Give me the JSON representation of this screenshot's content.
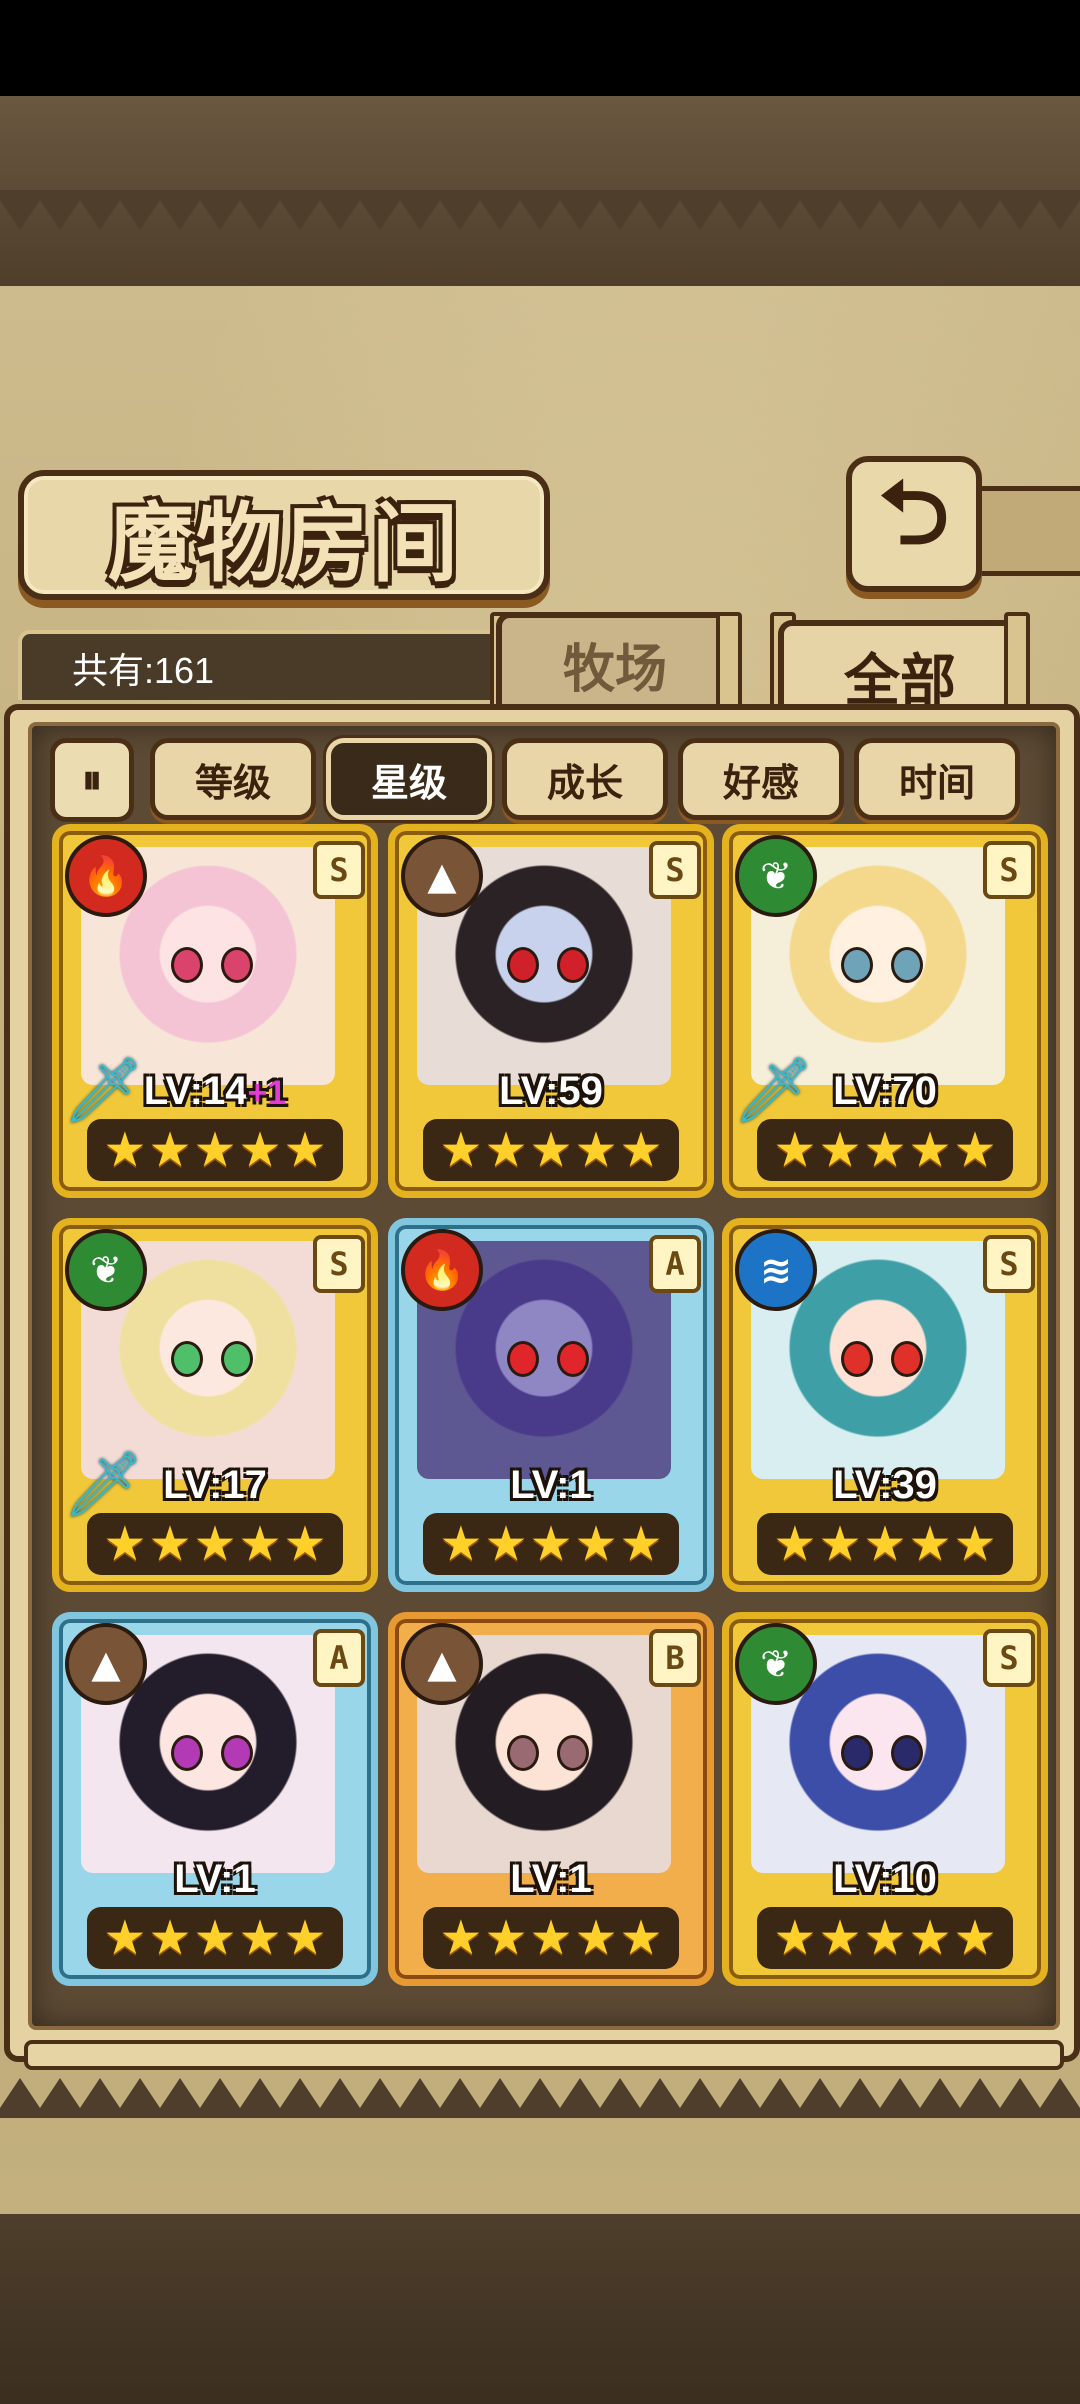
{
  "header": {
    "title": "魔物房间",
    "back_icon": "return-arrow-icon",
    "count_text": "共有:161"
  },
  "tabs": [
    {
      "label": "牧场",
      "active": false
    },
    {
      "label": "全部",
      "active": true
    }
  ],
  "sort": {
    "toggle_icon": "sort-order-icon",
    "buttons": [
      {
        "label": "等级",
        "selected": false
      },
      {
        "label": "星级",
        "selected": true
      },
      {
        "label": "成长",
        "selected": false
      },
      {
        "label": "好感",
        "selected": false
      },
      {
        "label": "时间",
        "selected": false
      }
    ]
  },
  "monsters": [
    {
      "level": "LV:14",
      "bonus": "+1",
      "stars": 5,
      "rarity": "S",
      "element": "fire",
      "equipped": true
    },
    {
      "level": "LV:59",
      "bonus": "",
      "stars": 5,
      "rarity": "S",
      "element": "earth",
      "equipped": false
    },
    {
      "level": "LV:70",
      "bonus": "",
      "stars": 5,
      "rarity": "S",
      "element": "wood",
      "equipped": true
    },
    {
      "level": "LV:17",
      "bonus": "",
      "stars": 5,
      "rarity": "S",
      "element": "wood",
      "equipped": true
    },
    {
      "level": "LV:1",
      "bonus": "",
      "stars": 5,
      "rarity": "A",
      "element": "fire",
      "equipped": false
    },
    {
      "level": "LV:39",
      "bonus": "",
      "stars": 5,
      "rarity": "S",
      "element": "water",
      "equipped": false
    },
    {
      "level": "LV:1",
      "bonus": "",
      "stars": 5,
      "rarity": "A",
      "element": "earth",
      "equipped": false
    },
    {
      "level": "LV:1",
      "bonus": "",
      "stars": 5,
      "rarity": "B",
      "element": "earth",
      "equipped": false
    },
    {
      "level": "LV:10",
      "bonus": "",
      "stars": 5,
      "rarity": "S",
      "element": "wood",
      "equipped": false
    }
  ],
  "colors": {
    "rarity_S": "#e3b21e",
    "rarity_A": "#7fc6de",
    "rarity_B": "#e89a32",
    "fire": "#d22a1e",
    "earth": "#7a5436",
    "wood": "#2f8a34",
    "water": "#1d74c7",
    "star": "#ffcf2a"
  }
}
